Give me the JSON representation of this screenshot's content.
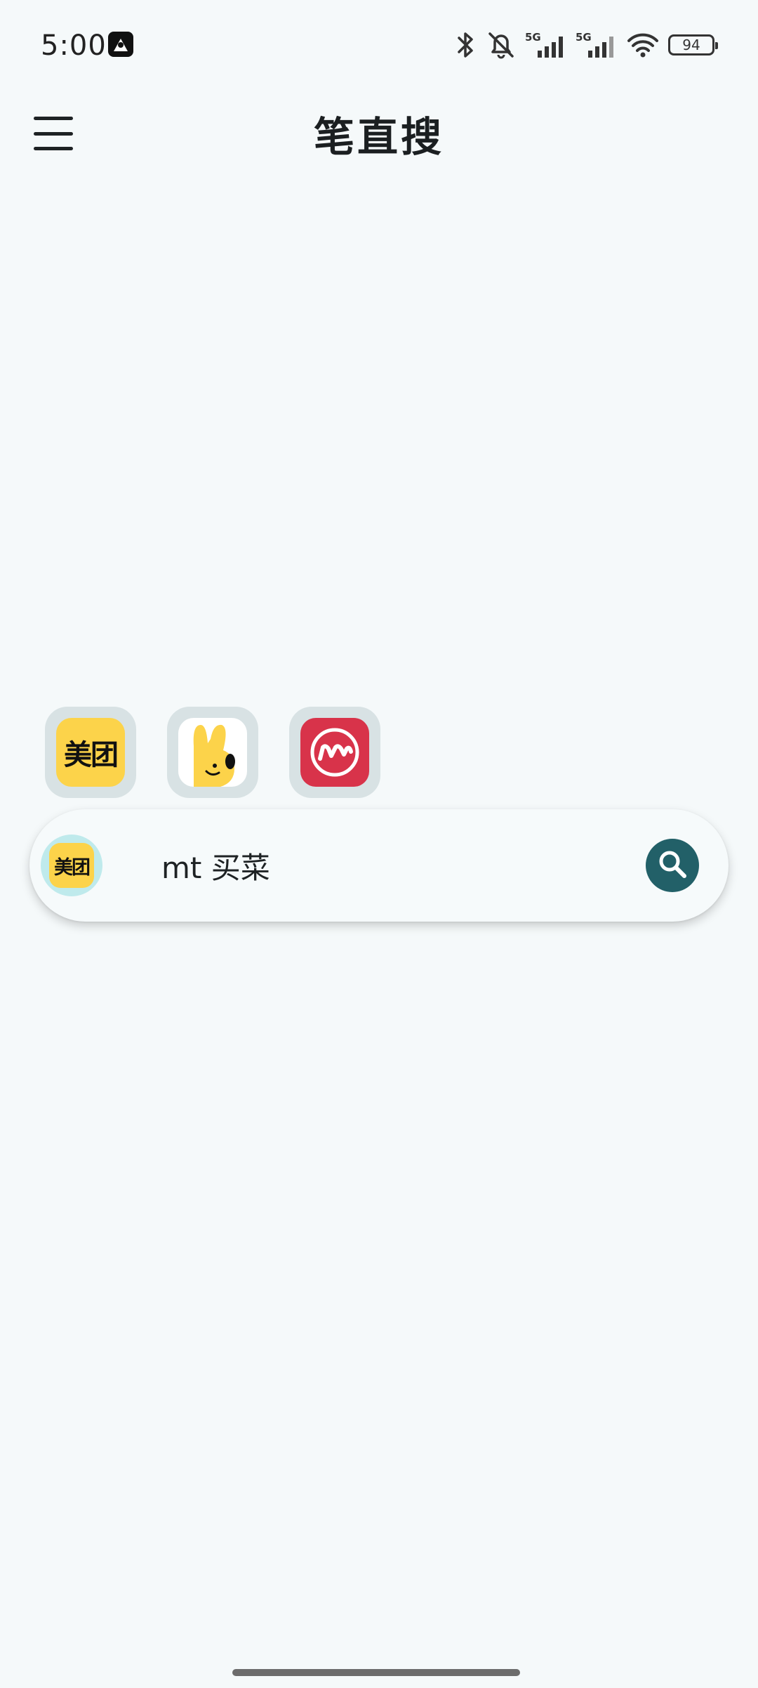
{
  "status_bar": {
    "time": "5:00",
    "network_1": "5G",
    "network_2": "5G",
    "battery": "94"
  },
  "header": {
    "title": "笔直搜"
  },
  "shortcuts": {
    "meituan_label": "美团"
  },
  "search": {
    "app_label": "美团",
    "query": "mt 买菜"
  },
  "colors": {
    "background": "#f5f9fa",
    "accent": "#226068",
    "meituan_yellow": "#fcd34a",
    "meitu_red": "#d8334a"
  }
}
